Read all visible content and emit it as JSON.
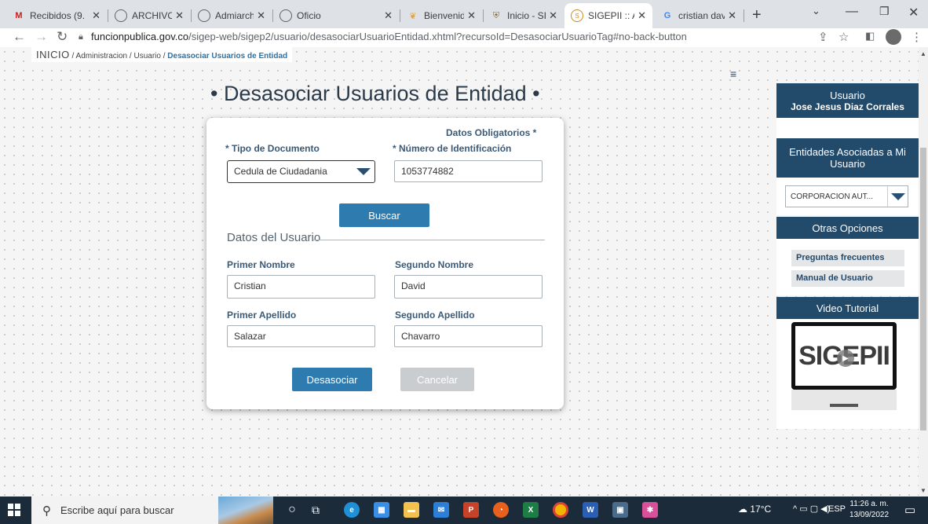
{
  "browser": {
    "tabs": [
      {
        "title": "Recibidos (9.",
        "favicon": "gmail-icon",
        "color": "#c5221f"
      },
      {
        "title": "ARCHIVO DC",
        "favicon": "globe-icon",
        "color": "#5f6368"
      },
      {
        "title": "Admiarchi",
        "favicon": "globe-icon",
        "color": "#5f6368"
      },
      {
        "title": "Oficio",
        "favicon": "globe-icon",
        "color": "#5f6368"
      },
      {
        "title": "Bienvenido a",
        "favicon": "feather-icon",
        "color": "#e8a33d"
      },
      {
        "title": "Inicio - SIGEP",
        "favicon": "shield-icon",
        "color": "#8a6d3b"
      },
      {
        "title": "SIGEPII :: Adr",
        "favicon": "sigep-icon",
        "color": "#c98a1b"
      },
      {
        "title": "cristian david",
        "favicon": "google-icon",
        "color": "#4285f4"
      }
    ],
    "url_host": "funcionpublica.gov.co",
    "url_path": "/sigep-web/sigep2/usuario/desasociarUsuarioEntidad.xhtml?recursoId=DesasociarUsuarioTag#no-back-button"
  },
  "breadcrumb": {
    "home": "INICIO",
    "sep1": " / ",
    "admin": "Administracion",
    "sep2": " / ",
    "user": "Usuario",
    "sep3": " / ",
    "current": "Desasociar Usuarios de Entidad"
  },
  "page": {
    "title": "• Desasociar Usuarios de Entidad •"
  },
  "form": {
    "required_note": "Datos Obligatorios *",
    "doc_type_label": "* Tipo de Documento",
    "doc_type_value": "Cedula de Ciudadania",
    "id_number_label": "* Número de Identificación",
    "id_number_value": "1053774882",
    "search_button": "Buscar",
    "section_title": "Datos del Usuario",
    "first_name_label": "Primer Nombre",
    "first_name_value": "Cristian",
    "second_name_label": "Segundo Nombre",
    "second_name_value": "David",
    "first_surname_label": "Primer Apellido",
    "first_surname_value": "Salazar",
    "second_surname_label": "Segundo Apellido",
    "second_surname_value": "Chavarro",
    "disassociate_button": "Desasociar",
    "cancel_button": "Cancelar"
  },
  "sidebar": {
    "user_heading": "Usuario",
    "user_name": "Jose Jesus Diaz Corrales",
    "entities_heading": "Entidades Asociadas a Mi Usuario",
    "entity_selected": "CORPORACION AUT...",
    "other_options_heading": "Otras Opciones",
    "faq_link": "Preguntas frecuentes",
    "manual_link": "Manual de Usuario",
    "video_heading": "Video Tutorial",
    "video_logo_text": "SIGEPII"
  },
  "taskbar": {
    "search_placeholder": "Escribe aquí para buscar",
    "weather": "17°C",
    "language": "ESP",
    "time": "11:26 a. m.",
    "date": "13/09/2022"
  },
  "colors": {
    "primary_blue": "#2e7bb0",
    "sidebar_header": "#224a6b",
    "taskbar": "#1c2b39"
  }
}
